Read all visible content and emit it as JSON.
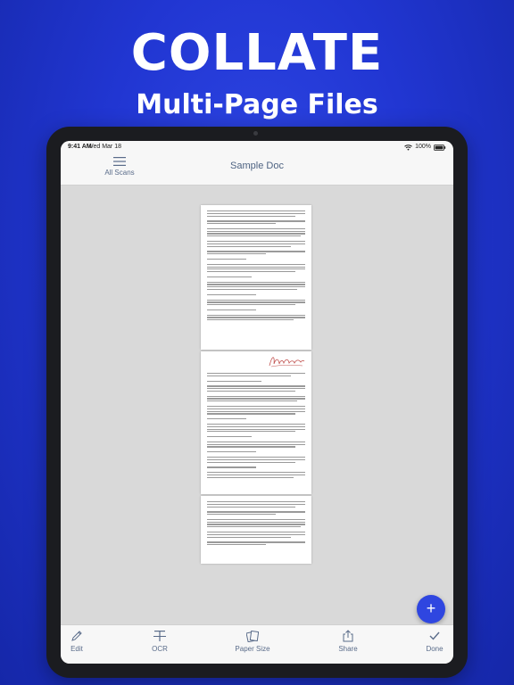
{
  "promo": {
    "headline": "COLLATE",
    "subline": "Multi-Page Files"
  },
  "status_bar": {
    "time": "9:41 AM",
    "date": "Wed Mar 18",
    "battery": "100%"
  },
  "nav": {
    "menu_label": "All Scans",
    "title": "Sample Doc"
  },
  "document": {
    "page_count": 3,
    "signature_icon": "handwritten-signature"
  },
  "fab": {
    "label": "+"
  },
  "toolbar": {
    "edit": "Edit",
    "ocr": "OCR",
    "paper_size": "Paper Size",
    "share": "Share",
    "done": "Done"
  },
  "colors": {
    "background": "#2136d2",
    "accent": "#2f46e0",
    "label": "#5a6c8a",
    "signature": "#c0504d"
  }
}
